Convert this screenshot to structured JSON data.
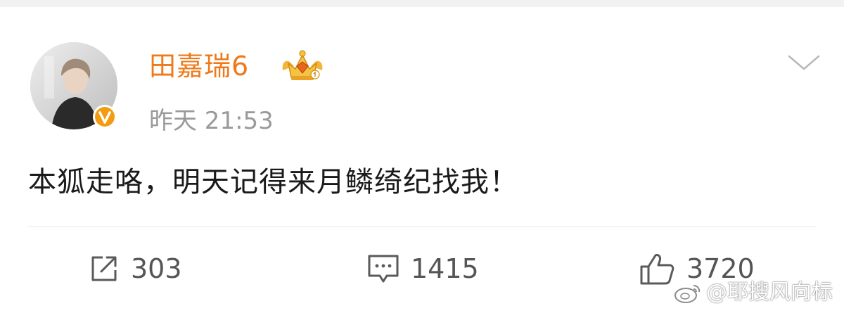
{
  "post": {
    "author": {
      "name": "田嘉瑞6",
      "avatar_icon": "user-avatar",
      "verified_icon": "verified-v-badge",
      "member_icon": "crown-icon"
    },
    "timestamp": "昨天 21:53",
    "text": "本狐走咯，明天记得来月鳞绮纪找我！",
    "menu_icon": "chevron-down-icon"
  },
  "actions": {
    "repost": {
      "icon": "repost-icon",
      "count": "303"
    },
    "comment": {
      "icon": "comment-icon",
      "count": "1415"
    },
    "like": {
      "icon": "like-icon",
      "count": "3720"
    }
  },
  "watermark": {
    "text": "@耶搜风向标",
    "icon": "weibo-logo-icon"
  },
  "colors": {
    "author_name": "#ef7a1a",
    "timestamp": "#9a9a9a",
    "badge": "#f39c12",
    "text": "#1a1a1a",
    "action": "#555555"
  }
}
